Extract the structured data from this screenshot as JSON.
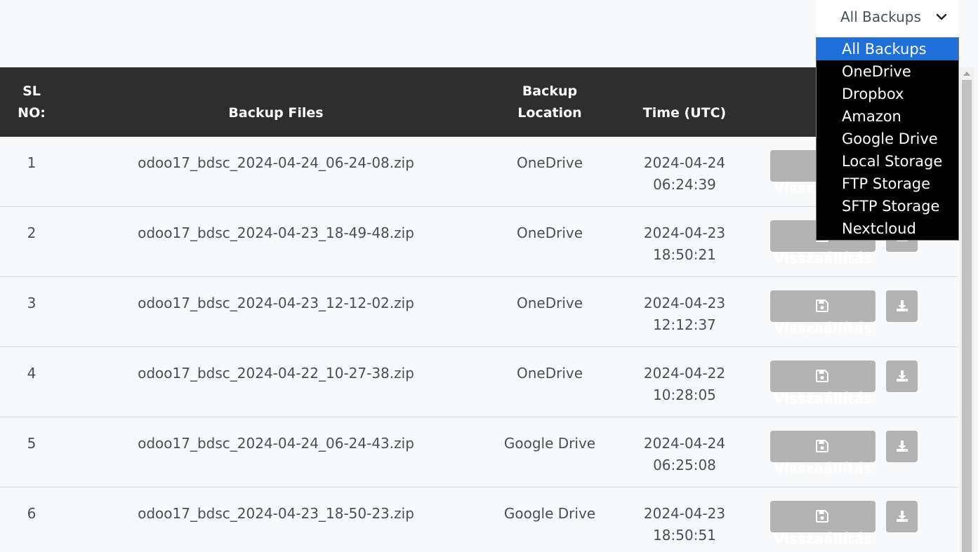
{
  "filter": {
    "selected": "All Backups",
    "options": [
      "All Backups",
      "OneDrive",
      "Dropbox",
      "Amazon",
      "Google Drive",
      "Local Storage",
      "FTP Storage",
      "SFTP Storage",
      "Nextcloud"
    ]
  },
  "table": {
    "headers": {
      "sl_line1": "SL",
      "sl_line2": "NO:",
      "files": "Backup Files",
      "location_line1": "Backup",
      "location_line2": "Location",
      "time": "Time (UTC)"
    },
    "restore_label": "Visszaállítás",
    "rows": [
      {
        "sl": "1",
        "file": "odoo17_bdsc_2024-04-24_06-24-08.zip",
        "location": "OneDrive",
        "date": "2024-04-24",
        "time": "06:24:39"
      },
      {
        "sl": "2",
        "file": "odoo17_bdsc_2024-04-23_18-49-48.zip",
        "location": "OneDrive",
        "date": "2024-04-23",
        "time": "18:50:21"
      },
      {
        "sl": "3",
        "file": "odoo17_bdsc_2024-04-23_12-12-02.zip",
        "location": "OneDrive",
        "date": "2024-04-23",
        "time": "12:12:37"
      },
      {
        "sl": "4",
        "file": "odoo17_bdsc_2024-04-22_10-27-38.zip",
        "location": "OneDrive",
        "date": "2024-04-22",
        "time": "10:28:05"
      },
      {
        "sl": "5",
        "file": "odoo17_bdsc_2024-04-24_06-24-43.zip",
        "location": "Google Drive",
        "date": "2024-04-24",
        "time": "06:25:08"
      },
      {
        "sl": "6",
        "file": "odoo17_bdsc_2024-04-23_18-50-23.zip",
        "location": "Google Drive",
        "date": "2024-04-23",
        "time": "18:50:51"
      }
    ]
  },
  "icons": {
    "filter_chevron": "chevron-down-icon",
    "restore": "floppy-disk-icon",
    "download": "download-icon"
  },
  "colors": {
    "header_bg": "#2e2e2e",
    "dropdown_bg": "#000000",
    "dropdown_selected": "#1f6fd9",
    "button_bg": "#b3b3b3"
  }
}
